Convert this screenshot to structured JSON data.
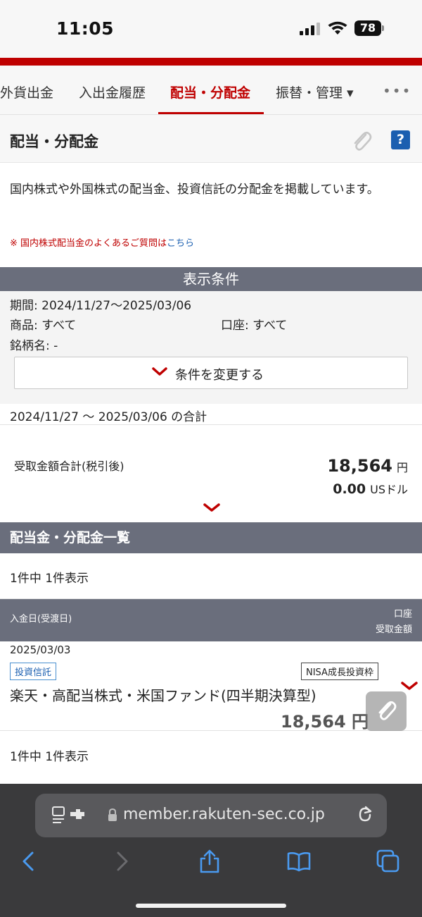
{
  "status": {
    "time": "11:05",
    "battery": "78"
  },
  "tabs": [
    {
      "label": "外貨出金"
    },
    {
      "label": "入出金履歴"
    },
    {
      "label": "配当・分配金"
    },
    {
      "label": "振替・管理 ▾"
    }
  ],
  "more_label": "•••",
  "page": {
    "title": "配当・分配金",
    "help_label": "?",
    "description": "国内株式や外国株式の配当金、投資信託の分配金を掲載しています。",
    "faq_prefix": "※ 国内株式配当金のよくあるご質問は",
    "faq_link": "こちら"
  },
  "conditions": {
    "header": "表示条件",
    "period": "期間: 2024/11/27〜2025/03/06",
    "product": "商品: すべて",
    "account": "口座: すべて",
    "brand": "銘柄名: -",
    "change_button": "条件を変更する"
  },
  "summary": {
    "period_total": "2024/11/27 〜 2025/03/06 の合計",
    "label": "受取金額合計(税引後)",
    "jpy_value": "18,564",
    "jpy_unit": "円",
    "usd_value": "0.00",
    "usd_unit": "USドル"
  },
  "list": {
    "header": "配当金・分配金一覧",
    "count_top": "1件中 1件表示",
    "count_bottom": "1件中 1件表示",
    "col_date": "入金日(受渡日)",
    "col_account": "口座",
    "col_amount": "受取金額",
    "rows": [
      {
        "date": "2025/03/03",
        "type": "投資信託",
        "account_badge": "NISA成長投資枠",
        "name": "楽天・高配当株式・米国ファンド(四半期決算型)",
        "amount": "18,564 円"
      }
    ]
  },
  "browser": {
    "url": "member.rakuten-sec.co.jp"
  },
  "colors": {
    "brand_red": "#bf0000",
    "header_gray": "#6a6e7c",
    "link_blue": "#1b5fb0"
  }
}
